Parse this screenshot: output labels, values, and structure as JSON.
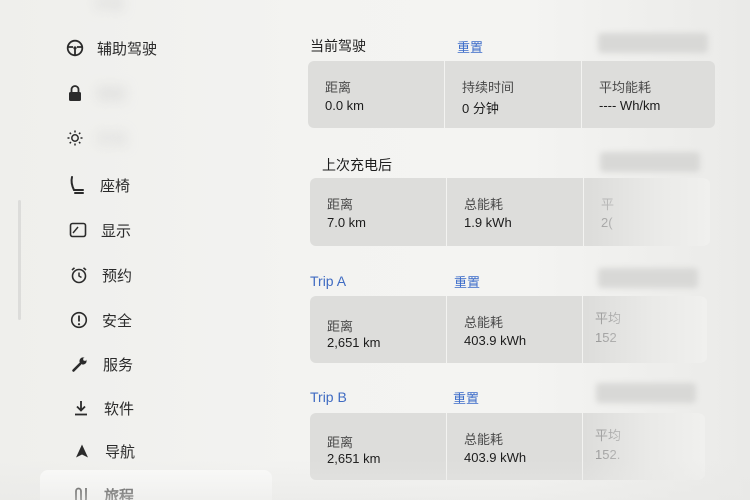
{
  "sidebar": {
    "top_cut_label": "外观",
    "items": [
      {
        "label": "辅助驾驶",
        "icon": "steering-wheel-icon"
      },
      {
        "label": "锁定",
        "icon": "lock-icon"
      },
      {
        "label": "灯光",
        "icon": "sun-icon"
      },
      {
        "label": "座椅",
        "icon": "seat-icon"
      },
      {
        "label": "显示",
        "icon": "display-icon"
      },
      {
        "label": "预约",
        "icon": "alarm-clock-icon"
      },
      {
        "label": "安全",
        "icon": "info-circle-icon"
      },
      {
        "label": "服务",
        "icon": "wrench-icon"
      },
      {
        "label": "软件",
        "icon": "download-icon"
      },
      {
        "label": "导航",
        "icon": "navigation-arrow-icon"
      },
      {
        "label": "旅程",
        "icon": "trip-icon"
      }
    ]
  },
  "current_drive": {
    "title": "当前驾驶",
    "reset": "重置",
    "cells": [
      {
        "label": "距离",
        "value": "0.0 km"
      },
      {
        "label": "持续时间",
        "value": "0 分钟"
      },
      {
        "label": "平均能耗",
        "value": "---- Wh/km"
      }
    ]
  },
  "since_charge": {
    "title": "上次充电后",
    "cells": [
      {
        "label": "距离",
        "value": "7.0 km"
      },
      {
        "label": "总能耗",
        "value": "1.9 kWh"
      },
      {
        "label": "平",
        "value": "2("
      }
    ]
  },
  "trip_a": {
    "title": "Trip A",
    "reset": "重置",
    "cells": [
      {
        "label": "距离",
        "value": "2,651 km"
      },
      {
        "label": "总能耗",
        "value": "403.9 kWh"
      },
      {
        "label": "平均",
        "value": "152"
      }
    ]
  },
  "trip_b": {
    "title": "Trip B",
    "reset": "重置",
    "cells": [
      {
        "label": "距离",
        "value": "2,651 km"
      },
      {
        "label": "总能耗",
        "value": "403.9 kWh"
      },
      {
        "label": "平均",
        "value": "152."
      }
    ]
  },
  "colors": {
    "accent_blue": "#3c6cc9",
    "panel": "#dddddb",
    "background": "#f2f2f0"
  }
}
